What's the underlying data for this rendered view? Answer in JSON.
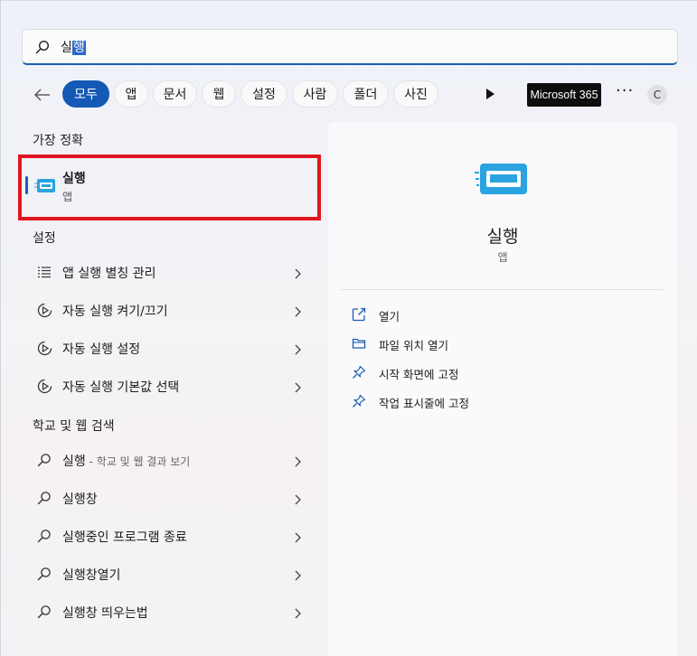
{
  "search": {
    "typed_prefix": "실",
    "typed_selected": "행"
  },
  "filters": {
    "chips": [
      "모두",
      "앱",
      "문서",
      "웹",
      "설정",
      "사람",
      "폴더",
      "사진"
    ],
    "brand": "Microsoft 365",
    "more": "···",
    "avatar_letter": "C"
  },
  "sections": {
    "best_match": "가장 정확",
    "settings": "설정",
    "web": "학교 및 웹 검색"
  },
  "best_match": {
    "name": "실행",
    "kind": "앱"
  },
  "settings_items": [
    {
      "label": "앱 실행 별칭 관리"
    },
    {
      "label": "자동 실행 켜기/끄기"
    },
    {
      "label": "자동 실행 설정"
    },
    {
      "label": "자동 실행 기본값 선택"
    }
  ],
  "web_items": [
    {
      "label": "실행",
      "suffix": " - 학교 및 웹 결과 보기"
    },
    {
      "label": "실행창"
    },
    {
      "label": "실행중인 프로그램 종료"
    },
    {
      "label": "실행창열기"
    },
    {
      "label": "실행창 띄우는법"
    }
  ],
  "preview": {
    "name": "실행",
    "kind": "앱",
    "actions": [
      "열기",
      "파일 위치 열기",
      "시작 화면에 고정",
      "작업 표시줄에 고정"
    ]
  },
  "colors": {
    "accent": "#1359b5",
    "highlight_border": "#e0161f",
    "icon_blue": "#2aa3e0"
  },
  "icons": {
    "search": "search-icon",
    "back": "back-arrow-icon",
    "play": "play-icon",
    "app": "run-app-icon",
    "list": "list-icon",
    "autoplay": "autoplay-icon",
    "chevron": "chevron-right-icon",
    "open": "open-external-icon",
    "folder": "folder-icon",
    "pin": "pin-icon"
  }
}
